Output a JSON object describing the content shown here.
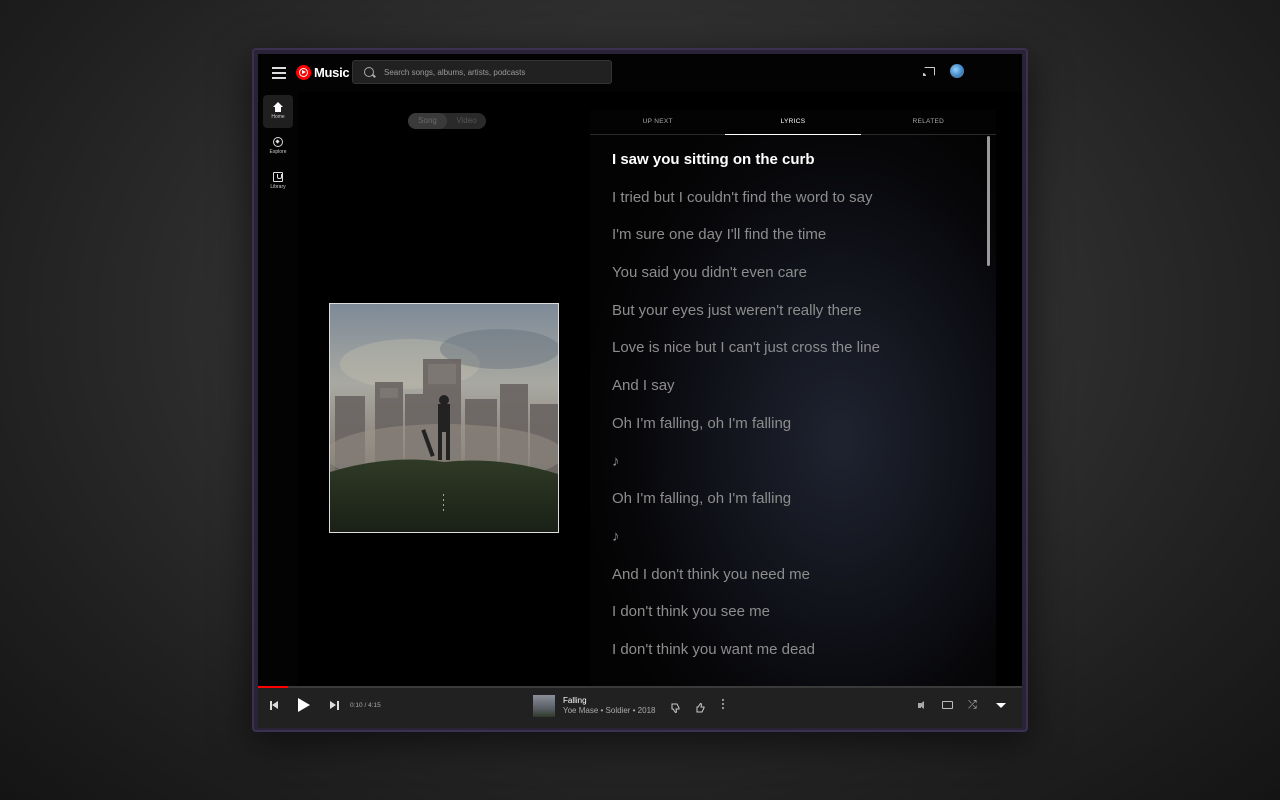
{
  "app": {
    "name": "Music"
  },
  "search": {
    "placeholder": "Search songs, albums, artists, podcasts"
  },
  "nav": {
    "items": [
      {
        "label": "Home",
        "icon": "home-icon",
        "active": true
      },
      {
        "label": "Explore",
        "icon": "compass-icon",
        "active": false
      },
      {
        "label": "Library",
        "icon": "library-icon",
        "active": false
      }
    ]
  },
  "toggle": {
    "song": "Song",
    "video": "Video",
    "selected": "Song"
  },
  "tabs": [
    {
      "label": "UP NEXT",
      "active": false
    },
    {
      "label": "LYRICS",
      "active": true
    },
    {
      "label": "RELATED",
      "active": false
    }
  ],
  "lyrics": [
    "I saw you sitting on the curb",
    "I tried but I couldn't find the word to say",
    "I'm sure one day I'll find the time",
    "You said you didn't even care",
    "But your eyes just weren't really there",
    "Love is nice but I can't just cross the line",
    "And I say",
    "Oh I'm falling, oh I'm falling",
    "♪",
    "Oh I'm falling, oh I'm falling",
    "♪",
    "And I don't think you need me",
    "I don't think you see me",
    "I don't think you want me dead"
  ],
  "current_lyric_index": 0,
  "player": {
    "time": "0:10 / 4:15",
    "progress": 0.039,
    "title": "Falling",
    "subtitle": "Yoe Mase • Soldier • 2018"
  },
  "colors": {
    "accent": "#ff0000",
    "background": "#030303"
  }
}
